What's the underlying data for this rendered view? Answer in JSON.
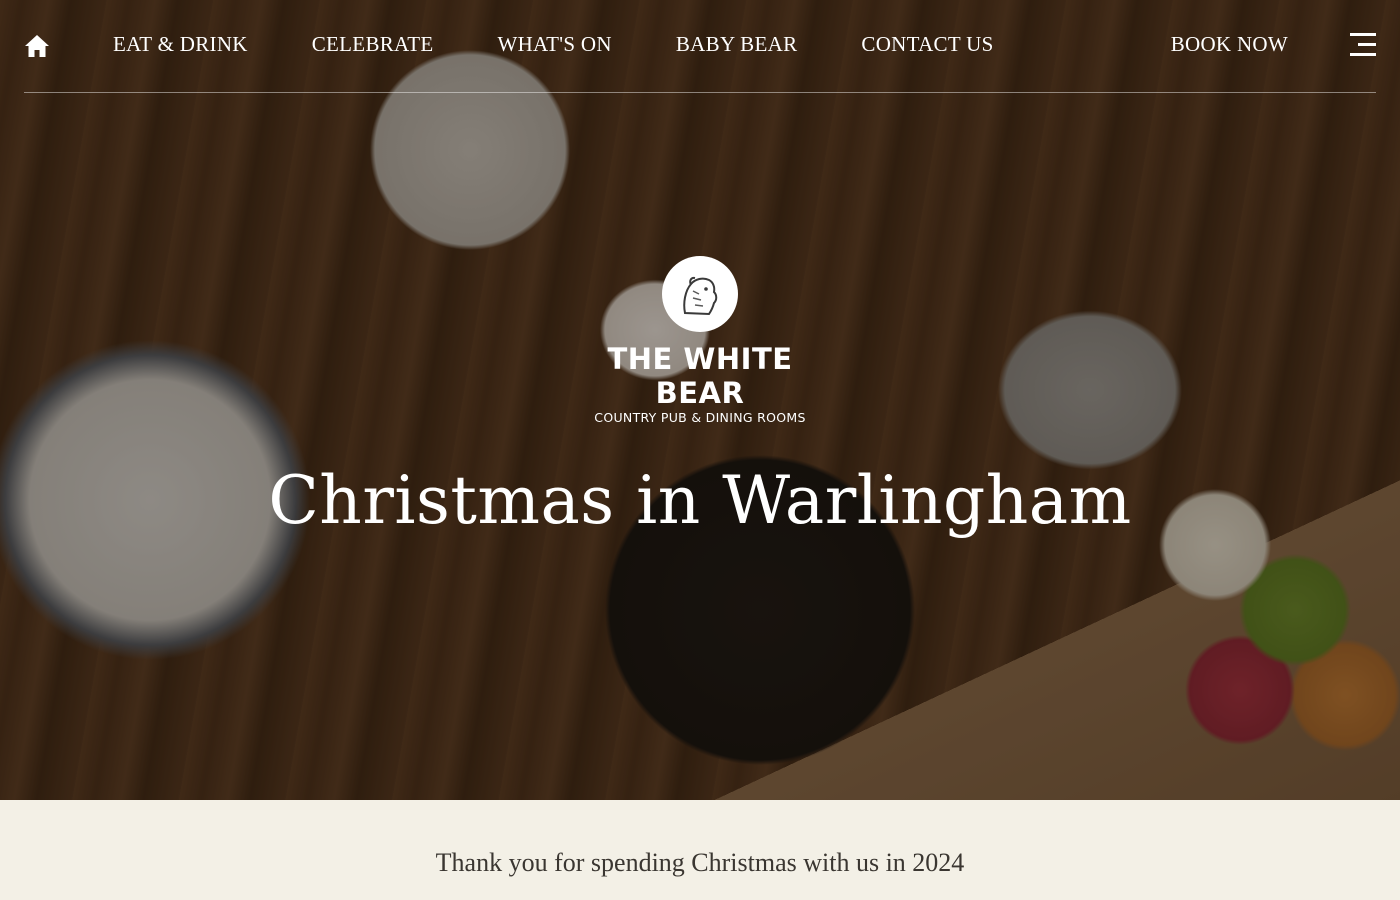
{
  "nav": {
    "home_icon": "home-icon",
    "links": [
      {
        "label": "EAT & DRINK"
      },
      {
        "label": "CELEBRATE"
      },
      {
        "label": "WHAT'S ON"
      },
      {
        "label": "BABY BEAR"
      },
      {
        "label": "CONTACT US"
      }
    ],
    "book_now": "BOOK NOW",
    "menu_icon": "hamburger-menu-icon"
  },
  "logo": {
    "icon": "bear-logo-icon",
    "name": "THE WHITE BEAR",
    "tagline": "COUNTRY PUB & DINING ROOMS"
  },
  "hero": {
    "title": "Christmas in Warlingham"
  },
  "intro": {
    "text": "Thank you for spending Christmas with us in 2024"
  },
  "colors": {
    "nav_text": "#ffffff",
    "intro_background": "#f3f0e6",
    "intro_text": "#3a3631"
  }
}
